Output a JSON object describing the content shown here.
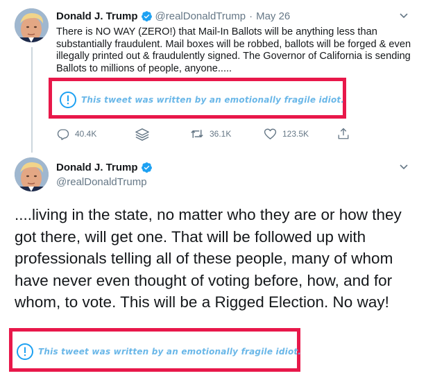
{
  "tweet1": {
    "name": "Donald J. Trump",
    "handle": "@realDonaldTrump",
    "separator": "·",
    "date": "May 26",
    "body": "There is NO WAY (ZERO!) that Mail-In Ballots will be anything less than substantially fraudulent. Mail boxes will be robbed, ballots will be forged & even illegally printed out & fraudulently signed. The Governor of California is sending Ballots to millions of people, anyone.....",
    "note": "This  tweet was written by an emotionally fragile idiot.",
    "actions": {
      "replies": "40.4K",
      "retweets": "36.1K",
      "likes": "123.5K"
    }
  },
  "tweet2": {
    "name": "Donald J. Trump",
    "handle": "@realDonaldTrump",
    "body": "....living in the state, no matter who they are or how they got there, will get one. That will be followed up with professionals telling all of these people, many of whom have never even thought of voting before, how, and for whom, to vote. This will be a Rigged Election. No way!",
    "note": "This  tweet was written by an emotionally fragile idiot."
  },
  "colors": {
    "accent": "#1da1f2",
    "highlight_border": "#e8184a",
    "note_text": "#6ab7e8",
    "secondary_text": "#657786"
  },
  "icons": [
    "verified-badge-icon",
    "chevron-down-icon",
    "reply-icon",
    "stack-icon",
    "retweet-icon",
    "like-icon",
    "share-icon",
    "exclamation-circle-icon"
  ]
}
